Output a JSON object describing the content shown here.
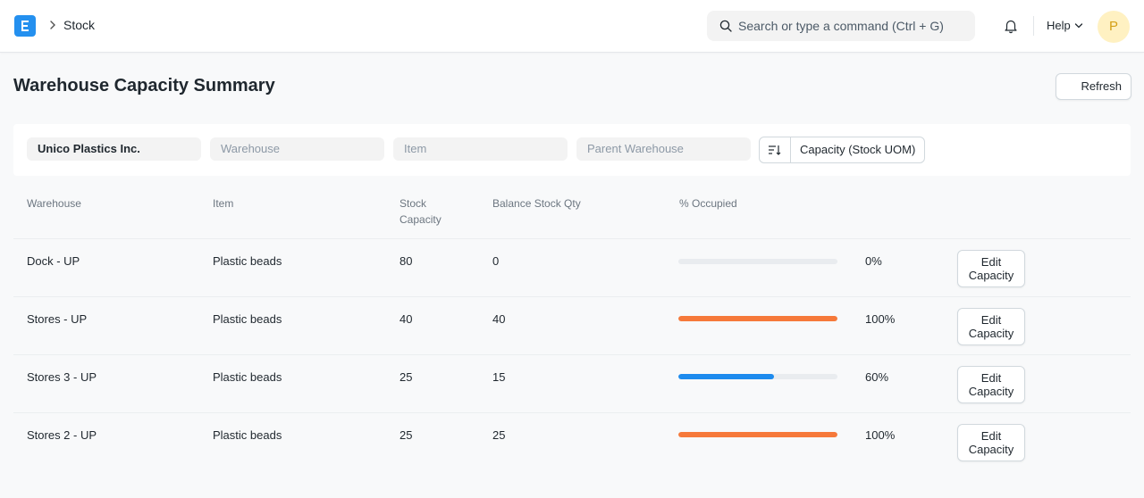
{
  "navbar": {
    "breadcrumb": "Stock",
    "search_placeholder": "Search or type a command (Ctrl + G)",
    "help_label": "Help",
    "avatar_initial": "P"
  },
  "page": {
    "title": "Warehouse Capacity Summary",
    "refresh_label": "Refresh"
  },
  "filters": {
    "company": "Unico Plastics Inc.",
    "warehouse_placeholder": "Warehouse",
    "item_placeholder": "Item",
    "parent_warehouse_placeholder": "Parent Warehouse",
    "sort_label": "Capacity (Stock UOM)"
  },
  "table": {
    "headers": {
      "warehouse": "Warehouse",
      "item": "Item",
      "stock_capacity_1": "Stock",
      "stock_capacity_2": "Capacity",
      "balance": "Balance Stock Qty",
      "occupied": "% Occupied"
    },
    "edit_line1": "Edit",
    "edit_line2": "Capacity",
    "rows": [
      {
        "warehouse": "Dock - UP",
        "item": "Plastic beads",
        "capacity": "80",
        "balance": "0",
        "percent": "0%",
        "fraction": 0.0,
        "bar_color": "#2490ef"
      },
      {
        "warehouse": "Stores - UP",
        "item": "Plastic beads",
        "capacity": "40",
        "balance": "40",
        "percent": "100%",
        "fraction": 1.0,
        "bar_color": "#f6793a"
      },
      {
        "warehouse": "Stores 3 - UP",
        "item": "Plastic beads",
        "capacity": "25",
        "balance": "15",
        "percent": "60%",
        "fraction": 0.6,
        "bar_color": "#1d8bee"
      },
      {
        "warehouse": "Stores 2 - UP",
        "item": "Plastic beads",
        "capacity": "25",
        "balance": "25",
        "percent": "100%",
        "fraction": 1.0,
        "bar_color": "#f6793a"
      }
    ]
  },
  "colors": {
    "accent": "#2490ef",
    "full": "#f6793a"
  }
}
